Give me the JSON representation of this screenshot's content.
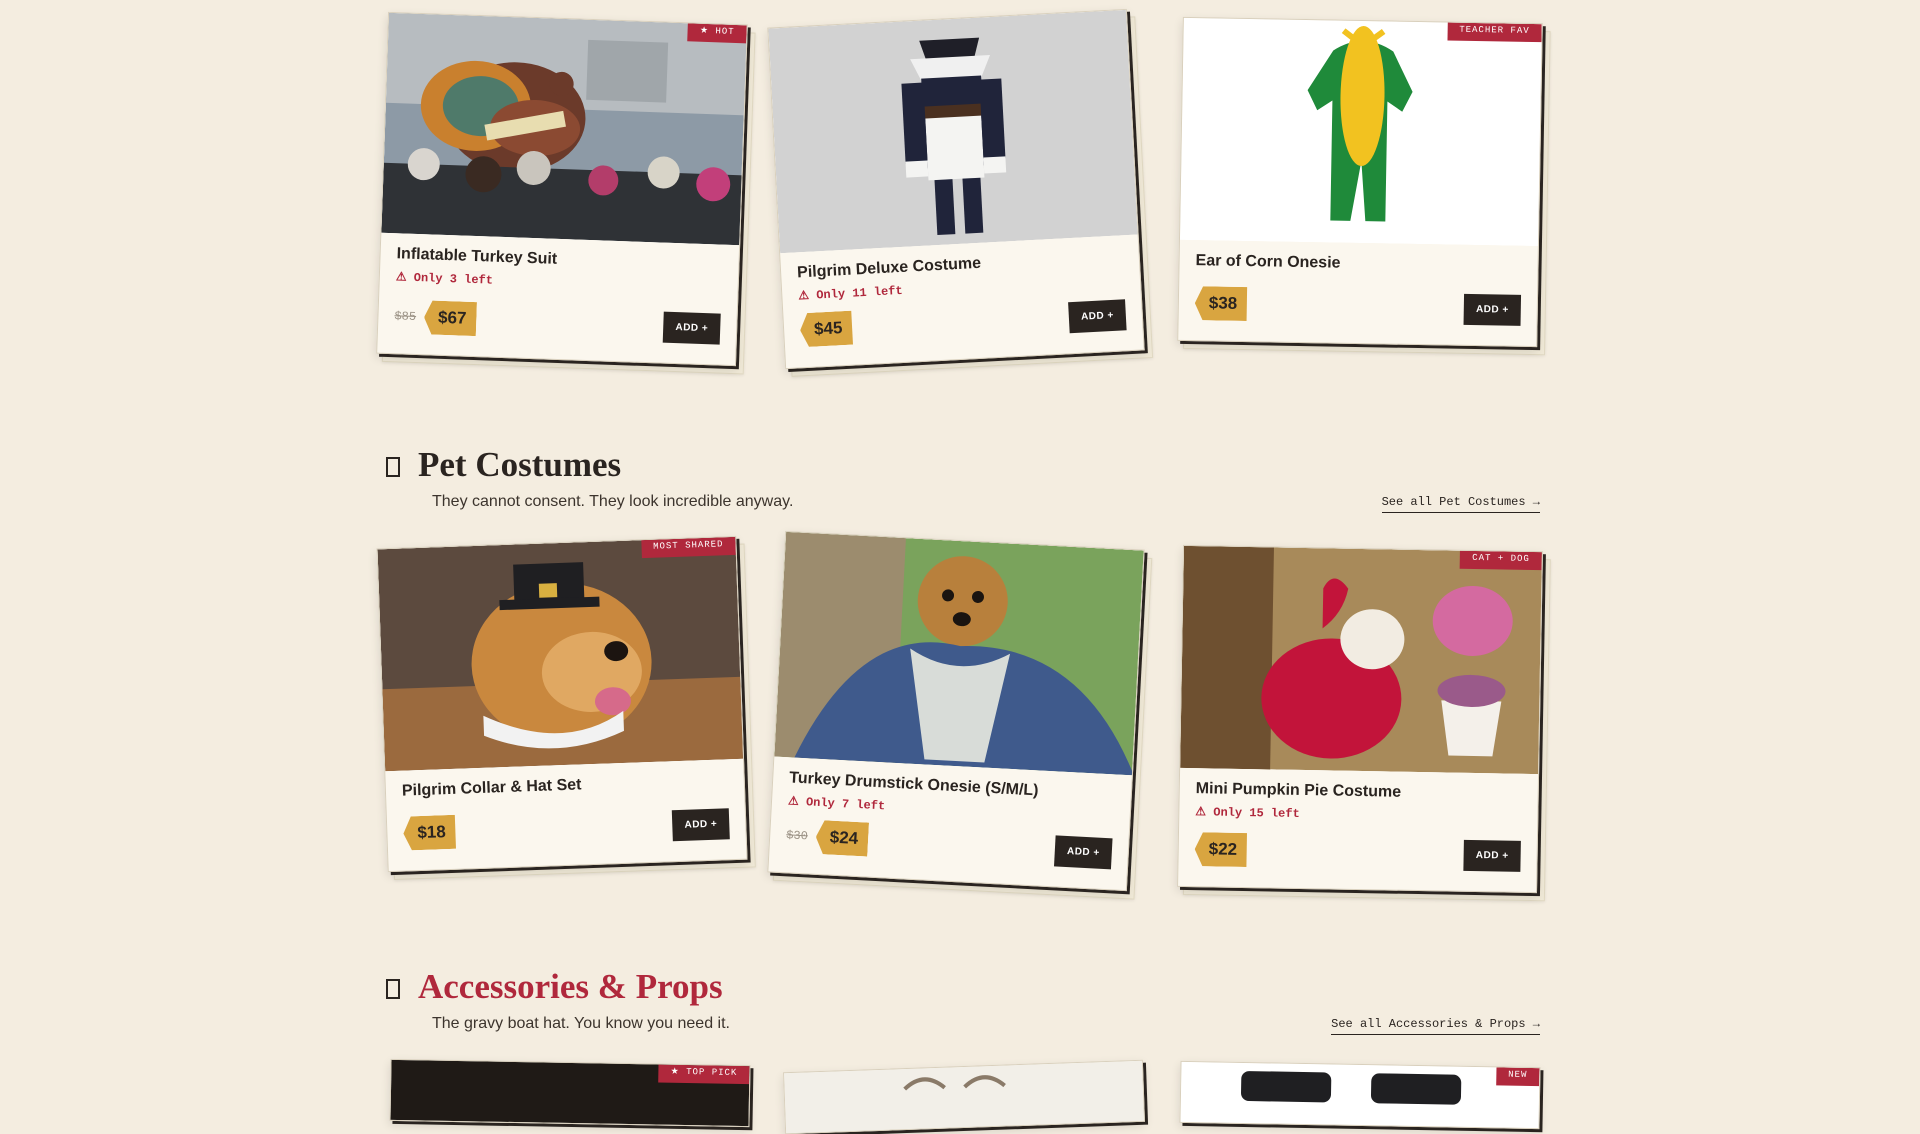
{
  "colors": {
    "page_bg": "#f4ede0",
    "accent_red": "#b0283c",
    "price_gold": "#d9a540",
    "ink": "#2a2420"
  },
  "row1": [
    {
      "name": "Inflatable Turkey Suit",
      "ribbon": "★ HOT",
      "stock": "⚠ Only 3 left",
      "old_price": "$85",
      "price": "$67",
      "add": "ADD +"
    },
    {
      "name": "Pilgrim Deluxe Costume",
      "stock": "⚠ Only 11 left",
      "price": "$45",
      "add": "ADD +"
    },
    {
      "name": "Ear of Corn Onesie",
      "ribbon": "TEACHER FAV",
      "price": "$38",
      "add": "ADD +"
    }
  ],
  "pet_section": {
    "title": "Pet Costumes",
    "subtitle": "They cannot consent. They look incredible anyway.",
    "see_all": "See all Pet Costumes →"
  },
  "row2": [
    {
      "name": "Pilgrim Collar & Hat Set",
      "ribbon": "MOST SHARED",
      "price": "$18",
      "add": "ADD +"
    },
    {
      "name": "Turkey Drumstick Onesie (S/M/L)",
      "stock": "⚠ Only 7 left",
      "old_price": "$30",
      "price": "$24",
      "add": "ADD +"
    },
    {
      "name": "Mini Pumpkin Pie Costume",
      "ribbon": "CAT + DOG",
      "stock": "⚠ Only 15 left",
      "price": "$22",
      "add": "ADD +"
    }
  ],
  "accessories_section": {
    "title": "Accessories & Props",
    "subtitle": "The gravy boat hat. You know you need it.",
    "see_all": "See all Accessories & Props →"
  },
  "row3_ribbons": [
    "★ TOP PICK",
    "NEW"
  ]
}
